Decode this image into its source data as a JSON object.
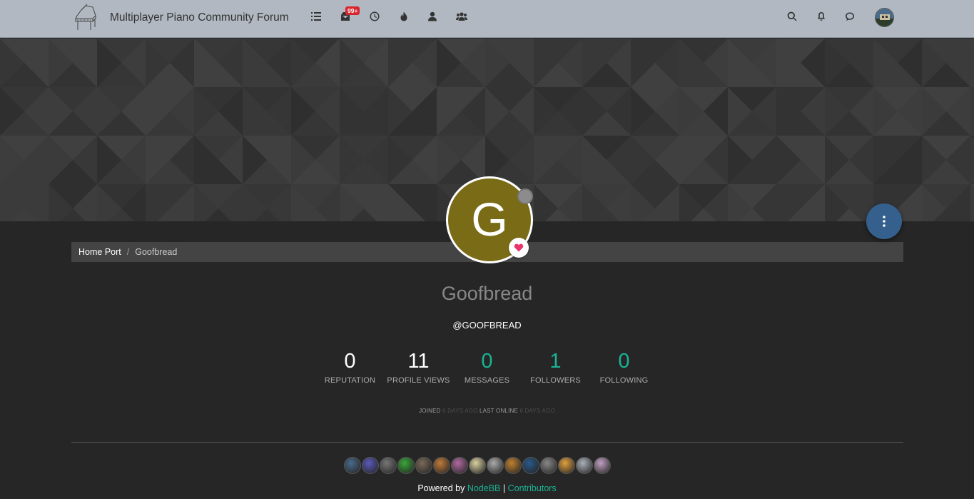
{
  "header": {
    "title": "Multiplayer Piano Community Forum",
    "nav_icons": [
      "categories-icon",
      "inbox-icon",
      "recent-icon",
      "popular-icon",
      "users-icon",
      "groups-icon"
    ],
    "notification_badge": "99+",
    "right_icons": [
      "search-icon",
      "bell-icon",
      "chat-icon"
    ]
  },
  "breadcrumb": {
    "home": "Home Port",
    "separator": "/",
    "current": "Goofbread"
  },
  "profile": {
    "avatar_letter": "G",
    "avatar_color": "#7a6b16",
    "fullname": "Goofbread",
    "username": "@GOOFBREAD",
    "stats": [
      {
        "value": "0",
        "label": "REPUTATION",
        "link": false
      },
      {
        "value": "11",
        "label": "PROFILE VIEWS",
        "link": false
      },
      {
        "value": "0",
        "label": "MESSAGES",
        "link": true
      },
      {
        "value": "1",
        "label": "FOLLOWERS",
        "link": true
      },
      {
        "value": "0",
        "label": "FOLLOWING",
        "link": true
      }
    ],
    "joined_label": "JOINED",
    "joined_value": "6 DAYS AGO",
    "last_online_label": "LAST ONLINE",
    "last_online_value": "6 DAYS AGO"
  },
  "footer": {
    "powered_by": "Powered by",
    "nodebb": "NodeBB",
    "separator": "|",
    "contributors": "Contributors"
  },
  "colors": {
    "accent": "#1ab394",
    "fab": "#35608d",
    "navbar": "#b1b8c1"
  }
}
